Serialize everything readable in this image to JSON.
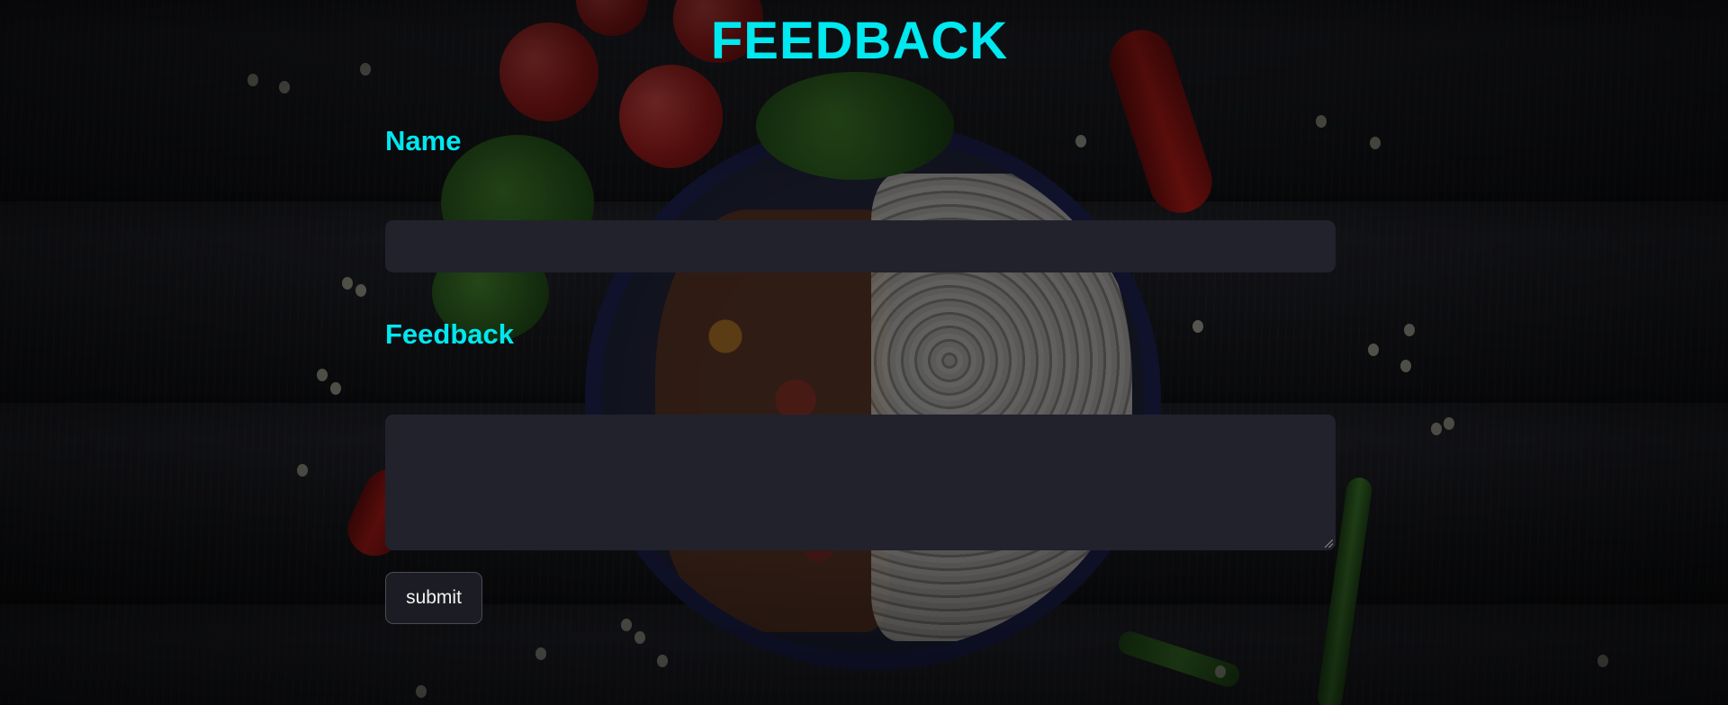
{
  "page": {
    "title": "FEEDBACK"
  },
  "form": {
    "name_label": "Name",
    "name_value": "",
    "feedback_label": "Feedback",
    "feedback_value": "",
    "submit_label": "submit"
  },
  "colors": {
    "accent": "#00e8f0",
    "field_background": "#22222d",
    "button_background": "#1c1d24"
  },
  "background_image": {
    "subject": "bowl of noodles with vegetables, tomatoes, herbs and chili peppers on dark wood"
  }
}
